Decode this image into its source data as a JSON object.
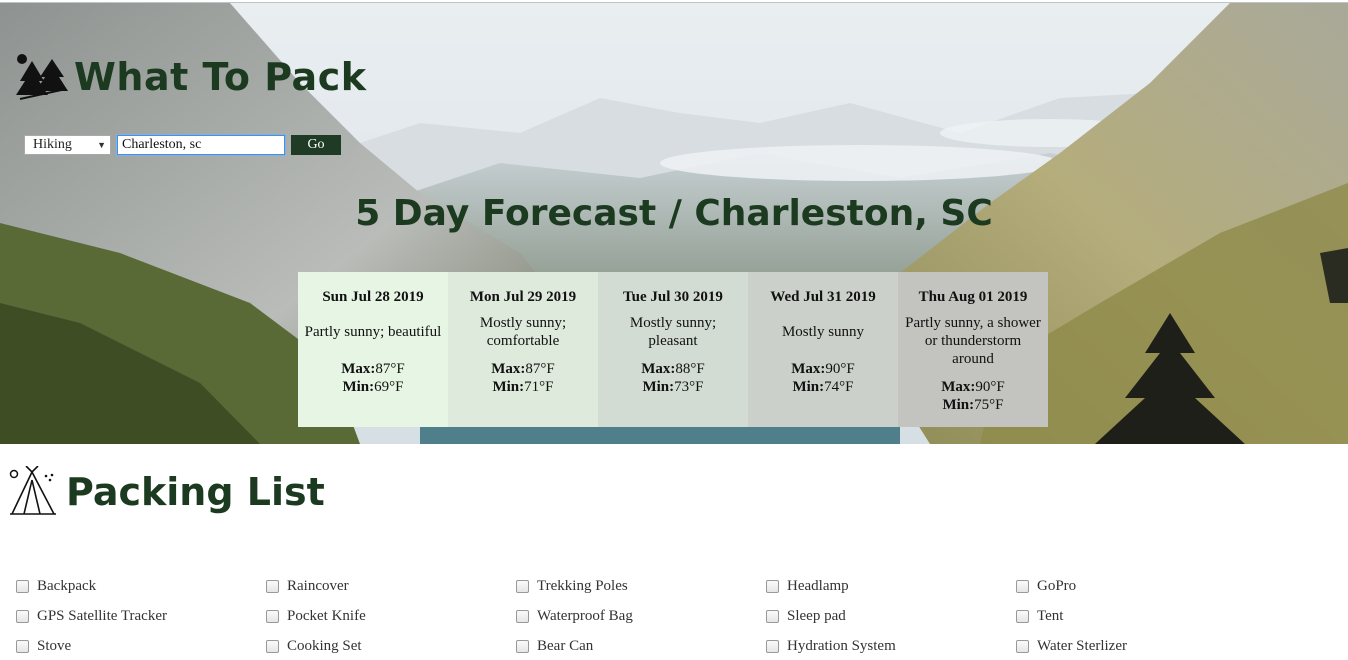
{
  "brand": {
    "title": "What To Pack",
    "logo_icon": "trees-icon"
  },
  "search": {
    "activity_selected": "Hiking",
    "location_value": "Charleston, sc",
    "go_label": "Go"
  },
  "forecast": {
    "title": "5 Day Forecast / Charleston, SC",
    "max_label": "Max:",
    "min_label": "Min:",
    "days": [
      {
        "date": "Sun Jul 28 2019",
        "condition": "Partly sunny; beautiful",
        "max": "87°F",
        "min": "69°F",
        "bg": "#e7f5e4"
      },
      {
        "date": "Mon Jul 29 2019",
        "condition": "Mostly sunny; comfortable",
        "max": "87°F",
        "min": "71°F",
        "bg": "#deeadb"
      },
      {
        "date": "Tue Jul 30 2019",
        "condition": "Mostly sunny; pleasant",
        "max": "88°F",
        "min": "73°F",
        "bg": "#d3dcd2"
      },
      {
        "date": "Wed Jul 31 2019",
        "condition": "Mostly sunny",
        "max": "90°F",
        "min": "74°F",
        "bg": "#cbd0ca"
      },
      {
        "date": "Thu Aug 01 2019",
        "condition": "Partly sunny, a shower or thunderstorm around",
        "max": "90°F",
        "min": "75°F",
        "bg": "#c3c3c0"
      }
    ]
  },
  "packing": {
    "title": "Packing List",
    "items": [
      "Backpack",
      "Raincover",
      "Trekking Poles",
      "Headlamp",
      "GoPro",
      "GPS Satellite Tracker",
      "Pocket Knife",
      "Waterproof Bag",
      "Sleep pad",
      "Tent",
      "Stove",
      "Cooking Set",
      "Bear Can",
      "Hydration System",
      "Water Sterlizer"
    ]
  },
  "colors": {
    "heading": "#1c3a1f",
    "go_button": "#1f3b26"
  }
}
